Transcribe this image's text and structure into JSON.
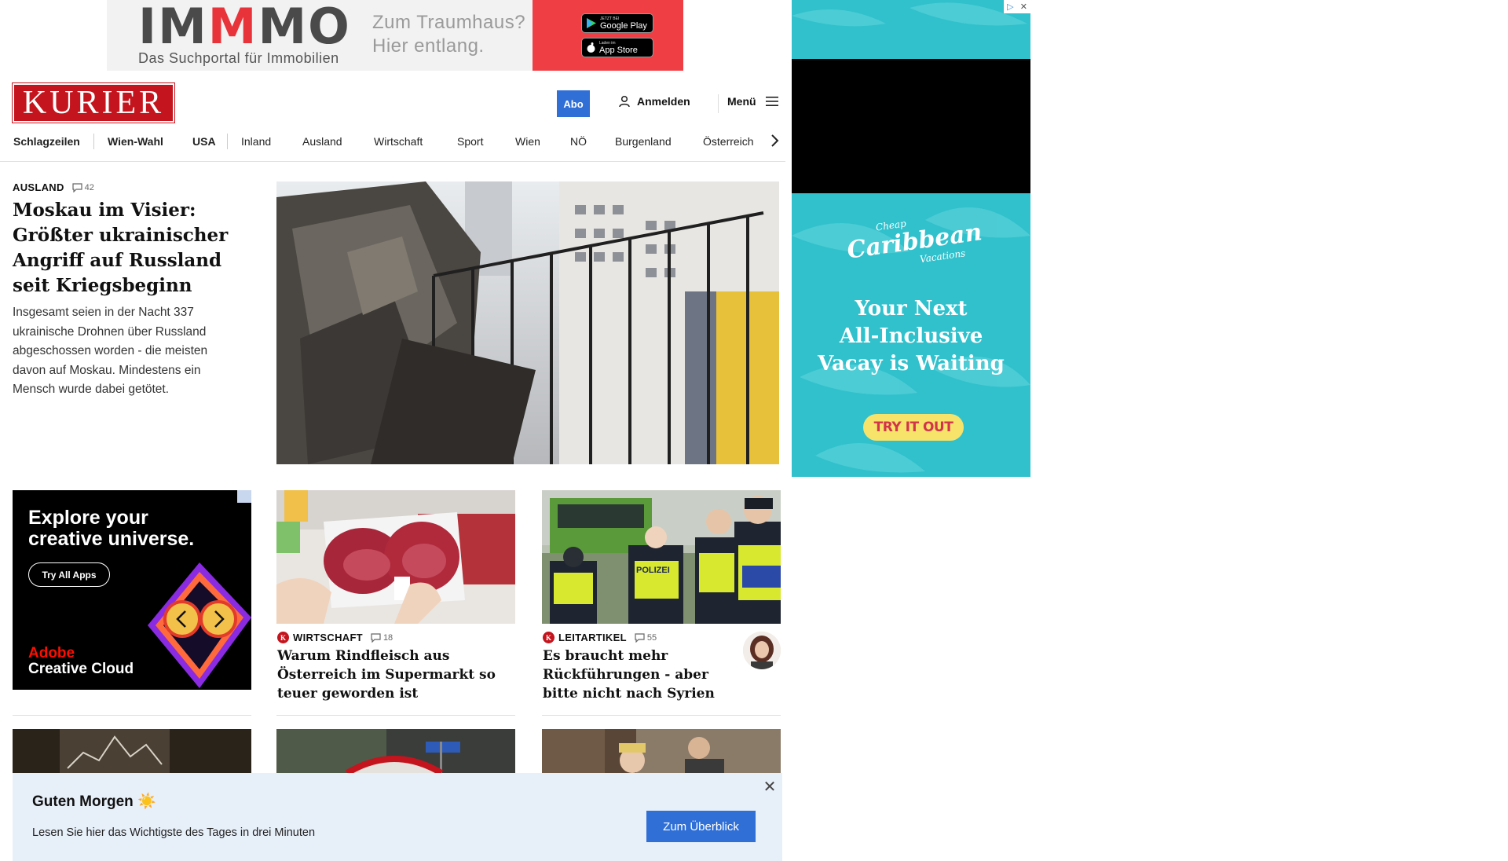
{
  "top_ad": {
    "logo": "IMMMO",
    "subtitle": "Das Suchportal für Immobilien",
    "tagline_1": "Zum Traumhaus?",
    "tagline_2": "Hier entlang.",
    "google_play_small": "JETZT BEI",
    "google_play": "Google Play",
    "app_store_small": "Laden im",
    "app_store": "App Store"
  },
  "header": {
    "logo": "KURIER",
    "abo": "Abo",
    "login": "Anmelden",
    "menu": "Menü"
  },
  "nav": {
    "items": [
      "Schlagzeilen",
      "Wien-Wahl",
      "USA",
      "Inland",
      "Ausland",
      "Wirtschaft",
      "Sport",
      "Wien",
      "NÖ",
      "Burgenland",
      "Österreich"
    ]
  },
  "hero": {
    "kicker": "AUSLAND",
    "comments": "42",
    "title": "Moskau im Visier: Größter ukrainischer Angriff auf Russland seit Kriegsbeginn",
    "text": "Insgesamt seien in der Nacht 337 ukrainische Drohnen über Russland abgeschossen worden - die meisten davon auf Moskau. Mindestens ein Mensch wurde dabei getötet."
  },
  "side_ad": {
    "brand_top": "Cheap",
    "brand": "Caribbean",
    "brand_bottom": "Vacations",
    "headline_1": "Your Next",
    "headline_2": "All-Inclusive",
    "headline_3": "Vacay is Waiting",
    "cta": "TRY IT OUT"
  },
  "adobe_ad": {
    "headline_1": "Explore your",
    "headline_2": "creative universe.",
    "button": "Try All Apps",
    "brand_1": "Adobe",
    "brand_2": "Creative Cloud"
  },
  "cards": [
    {
      "kicker": "WIRTSCHAFT",
      "comments": "18",
      "title": "Warum Rindfleisch aus Österreich im Supermarkt so teuer geworden ist"
    },
    {
      "kicker": "LEITARTIKEL",
      "comments": "55",
      "title": "Es braucht mehr Rückführungen - aber bitte nicht nach Syrien"
    }
  ],
  "police_label": "POLIZEI",
  "notification": {
    "title": "Guten Morgen ☀️",
    "text": "Lesen Sie hier das Wichtigste des Tages in drei Minuten",
    "button": "Zum Überblick"
  },
  "colors": {
    "brand_red": "#c4141d",
    "accent_blue": "#2f6fd6",
    "notification_bg": "#e7eff9",
    "ad_teal": "#31c1cc"
  }
}
